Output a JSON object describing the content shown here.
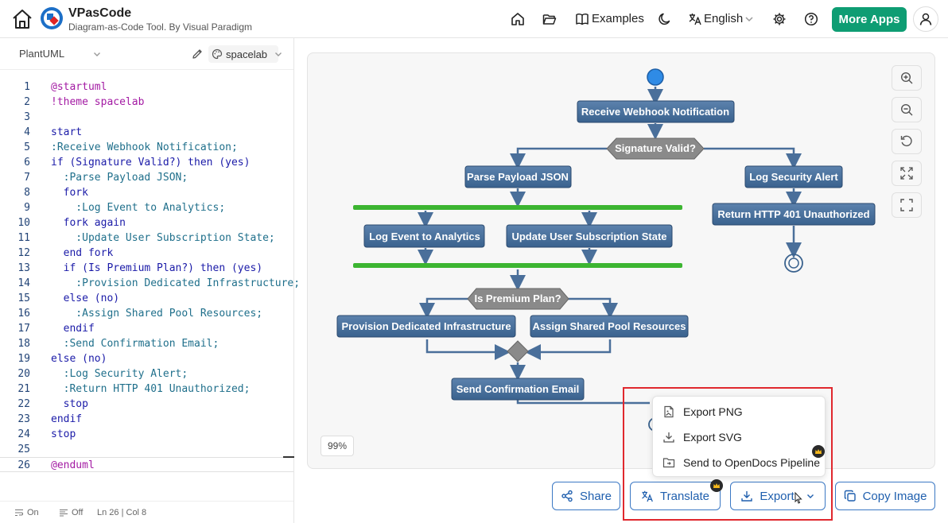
{
  "header": {
    "app_title": "VPasCode",
    "app_subtitle": "Diagram-as-Code Tool. By Visual Paradigm",
    "examples_label": "Examples",
    "language_label": "English",
    "more_apps_label": "More Apps"
  },
  "editor": {
    "language": "PlantUML",
    "theme": "spacelab",
    "lines": [
      {
        "n": "1",
        "t": "@startuml"
      },
      {
        "n": "2",
        "t": "!theme spacelab"
      },
      {
        "n": "3",
        "t": ""
      },
      {
        "n": "4",
        "t": "start"
      },
      {
        "n": "5",
        "t": ":Receive Webhook Notification;"
      },
      {
        "n": "6",
        "t": "if (Signature Valid?) then (yes)"
      },
      {
        "n": "7",
        "t": "  :Parse Payload JSON;"
      },
      {
        "n": "8",
        "t": "  fork"
      },
      {
        "n": "9",
        "t": "    :Log Event to Analytics;"
      },
      {
        "n": "10",
        "t": "  fork again"
      },
      {
        "n": "11",
        "t": "    :Update User Subscription State;"
      },
      {
        "n": "12",
        "t": "  end fork"
      },
      {
        "n": "13",
        "t": "  if (Is Premium Plan?) then (yes)"
      },
      {
        "n": "14",
        "t": "    :Provision Dedicated Infrastructure;"
      },
      {
        "n": "15",
        "t": "  else (no)"
      },
      {
        "n": "16",
        "t": "    :Assign Shared Pool Resources;"
      },
      {
        "n": "17",
        "t": "  endif"
      },
      {
        "n": "18",
        "t": "  :Send Confirmation Email;"
      },
      {
        "n": "19",
        "t": "else (no)"
      },
      {
        "n": "20",
        "t": "  :Log Security Alert;"
      },
      {
        "n": "21",
        "t": "  :Return HTTP 401 Unauthorized;"
      },
      {
        "n": "22",
        "t": "  stop"
      },
      {
        "n": "23",
        "t": "endif"
      },
      {
        "n": "24",
        "t": "stop"
      },
      {
        "n": "25",
        "t": ""
      },
      {
        "n": "26",
        "t": "@enduml"
      }
    ],
    "status": {
      "wrap_label": "On",
      "minimap_label": "Off",
      "cursor": "Ln 26 | Col 8"
    }
  },
  "diagram": {
    "nodes": {
      "receive": "Receive Webhook Notification",
      "sig_valid": "Signature Valid?",
      "parse": "Parse Payload JSON",
      "log_alert": "Log Security Alert",
      "return401": "Return HTTP 401 Unauthorized",
      "log_event": "Log Event to Analytics",
      "update_sub": "Update User Subscription State",
      "premium": "Is Premium Plan?",
      "provision": "Provision Dedicated Infrastructure",
      "assign": "Assign Shared Pool Resources",
      "send_email": "Send Confirmation Email"
    },
    "zoom_level": "99%",
    "colors": {
      "node_fill": "#446e9b",
      "node_border": "#2b4a6f",
      "diamond_fill": "#888888",
      "fork_bar": "#3cb531",
      "start_fill": "#2f8be6",
      "arrow": "#4a6f9a"
    }
  },
  "actions": {
    "share": "Share",
    "translate": "Translate",
    "export": "Export",
    "copy_image": "Copy Image"
  },
  "export_menu": {
    "items": [
      "Export PNG",
      "Export SVG",
      "Send to OpenDocs Pipeline"
    ]
  }
}
